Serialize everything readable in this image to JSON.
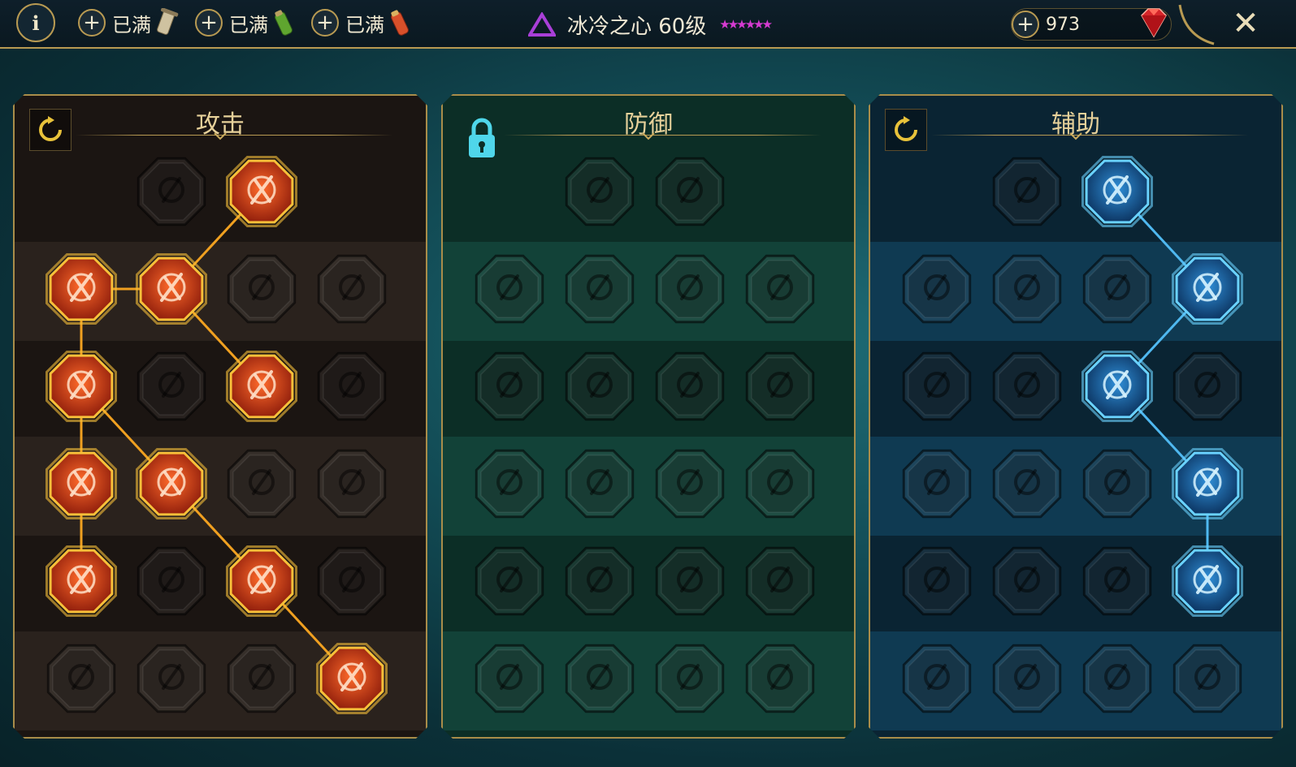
{
  "topbar": {
    "info_label": "i",
    "resources": [
      {
        "label": "已满",
        "icon": "scroll-icon"
      },
      {
        "label": "已满",
        "icon": "green-potion-icon"
      },
      {
        "label": "已满",
        "icon": "red-potion-icon"
      }
    ],
    "hero_name": "冰冷之心 60级",
    "stars": "★★★★★★",
    "gems": "973",
    "close_label": "✕"
  },
  "panels": [
    {
      "id": "attack",
      "title": "攻击",
      "header_icon": "reset-icon",
      "accent": "#f0a020",
      "rows": [
        [
          null,
          {
            "icon": "crossed-swords-icon",
            "active": false
          },
          {
            "icon": "dagger-slash-icon",
            "active": true
          },
          null
        ],
        [
          {
            "icon": "demon-heart-icon",
            "active": true
          },
          {
            "icon": "blade-rush-icon",
            "active": true
          },
          {
            "icon": "shield-break-icon",
            "active": false
          },
          {
            "icon": "cursed-heart-icon",
            "active": false
          }
        ],
        [
          {
            "icon": "arrow-pierce-icon",
            "active": true
          },
          {
            "icon": "jaws-icon",
            "active": false
          },
          {
            "icon": "skull-slash-icon",
            "active": true
          },
          {
            "icon": "knife-hand-icon",
            "active": false
          }
        ],
        [
          {
            "icon": "bleeding-heart-icon",
            "active": true
          },
          {
            "icon": "fist-sword-icon",
            "active": true
          },
          {
            "icon": "axe-icon",
            "active": false
          },
          {
            "icon": "chain-lightning-icon",
            "active": false
          }
        ],
        [
          {
            "icon": "arrow-burst-icon",
            "active": true
          },
          {
            "icon": "double-skull-icon",
            "active": false
          },
          {
            "icon": "sword-arc-icon",
            "active": true
          },
          {
            "icon": "strong-man-icon",
            "active": false
          }
        ],
        [
          {
            "icon": "sparkle-sword-icon",
            "active": false
          },
          {
            "icon": "knight-helm-icon",
            "active": false
          },
          {
            "icon": "ogre-icon",
            "active": false
          },
          {
            "icon": "flaming-skull-icon",
            "active": true
          }
        ]
      ],
      "links": [
        [
          0,
          2,
          1,
          1
        ],
        [
          1,
          0,
          1,
          1
        ],
        [
          1,
          1,
          2,
          2
        ],
        [
          1,
          0,
          2,
          0
        ],
        [
          2,
          0,
          3,
          0
        ],
        [
          2,
          0,
          3,
          1
        ],
        [
          3,
          0,
          4,
          0
        ],
        [
          3,
          1,
          4,
          2
        ],
        [
          4,
          2,
          5,
          3
        ]
      ]
    },
    {
      "id": "defense",
      "title": "防御",
      "header_icon": "lock-icon",
      "accent": "#2aa0a0",
      "rows": [
        [
          null,
          {
            "icon": "armor-plates-icon",
            "active": false
          },
          {
            "icon": "raised-fist-icon",
            "active": false
          },
          null
        ],
        [
          {
            "icon": "chest-guard-icon",
            "active": false
          },
          {
            "icon": "heart-hand-icon",
            "active": false
          },
          {
            "icon": "stone-golem-icon",
            "active": false
          },
          {
            "icon": "blocked-blade-icon",
            "active": false
          }
        ],
        [
          {
            "icon": "dodge-icon",
            "active": false
          },
          {
            "icon": "knight-shield-icon",
            "active": false
          },
          {
            "icon": "heart-icon",
            "active": false
          },
          {
            "icon": "aura-head-icon",
            "active": false
          }
        ],
        [
          {
            "icon": "rally-icon",
            "active": false
          },
          {
            "icon": "hourglass-icon",
            "active": false
          },
          {
            "icon": "blood-hand-icon",
            "active": false
          },
          {
            "icon": "bull-icon",
            "active": false
          }
        ],
        [
          {
            "icon": "dash-icon",
            "active": false
          },
          {
            "icon": "drops-icon",
            "active": false
          },
          {
            "icon": "skull-sun-icon",
            "active": false
          },
          {
            "icon": "hand-swirl-icon",
            "active": false
          }
        ],
        [
          {
            "icon": "beast-icon",
            "active": false
          },
          {
            "icon": "winged-shield-icon",
            "active": false
          },
          {
            "icon": "bearded-face-icon",
            "active": false
          },
          {
            "icon": "muscle-man-icon",
            "active": false
          }
        ]
      ],
      "links": []
    },
    {
      "id": "support",
      "title": "辅助",
      "header_icon": "reset-icon",
      "accent": "#4fb8f0",
      "rows": [
        [
          null,
          {
            "icon": "heart-plus-icon",
            "active": false
          },
          {
            "icon": "spin-strike-icon",
            "active": true
          },
          null
        ],
        [
          {
            "icon": "praying-hands-icon",
            "active": false
          },
          {
            "icon": "shield-wave-icon",
            "active": false
          },
          {
            "icon": "smoke-skull-icon",
            "active": false
          },
          {
            "icon": "swift-boot-icon",
            "active": true
          }
        ],
        [
          {
            "icon": "blessed-man-icon",
            "active": false
          },
          {
            "icon": "lightning-shield-icon",
            "active": false
          },
          {
            "icon": "shock-icon",
            "active": true
          },
          {
            "icon": "shadow-figure-icon",
            "active": false
          }
        ],
        [
          {
            "icon": "chained-heart-icon",
            "active": false
          },
          {
            "icon": "fireball-icon",
            "active": false
          },
          {
            "icon": "open-book-icon",
            "active": false
          },
          {
            "icon": "angry-eyes-icon",
            "active": true
          }
        ],
        [
          {
            "icon": "compass-icon",
            "active": false
          },
          {
            "icon": "speed-boot-icon",
            "active": false
          },
          {
            "icon": "eye-icon",
            "active": false
          },
          {
            "icon": "puppet-icon",
            "active": true
          }
        ],
        [
          {
            "icon": "potion-icon",
            "active": false
          },
          {
            "icon": "horned-skull-icon",
            "active": false
          },
          {
            "icon": "fist-gauntlet-icon",
            "active": false
          },
          {
            "icon": "eagle-icon",
            "active": false
          }
        ]
      ],
      "links": [
        [
          0,
          2,
          1,
          3
        ],
        [
          1,
          3,
          2,
          2
        ],
        [
          2,
          2,
          3,
          3
        ],
        [
          3,
          3,
          4,
          3
        ]
      ]
    }
  ]
}
